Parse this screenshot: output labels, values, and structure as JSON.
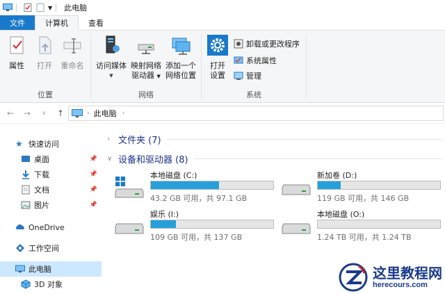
{
  "window": {
    "title": "此电脑"
  },
  "tabs": [
    {
      "label": "文件"
    },
    {
      "label": "计算机"
    },
    {
      "label": "查看"
    }
  ],
  "ribbon": {
    "location_group": {
      "label": "位置",
      "properties": "属性",
      "open": "打开",
      "rename": "重命名"
    },
    "network_group": {
      "label": "网络",
      "media_line1": "访问媒体",
      "map_line1": "映射网络",
      "map_line2": "驱动器",
      "add_line1": "添加一个",
      "add_line2": "网络位置"
    },
    "system_group": {
      "label": "系统",
      "settings_line1": "打开",
      "settings_line2": "设置",
      "uninstall": "卸载或更改程序",
      "sysprops": "系统属性",
      "manage": "管理"
    }
  },
  "address": {
    "path": "此电脑"
  },
  "nav": {
    "quick_access": "快速访问",
    "desktop": "桌面",
    "downloads": "下载",
    "documents": "文档",
    "pictures": "图片",
    "onedrive": "OneDrive",
    "workspace": "工作空间",
    "this_pc": "此电脑",
    "objects3d": "3D 对象"
  },
  "sections": {
    "folders": "文件夹 (7)",
    "devices": "设备和驱动器 (8)"
  },
  "drives": [
    {
      "name": "本地磁盘 (C:)",
      "usage": "43.2 GB 可用，共 97.1 GB",
      "used_fraction": 0.555
    },
    {
      "name": "新加卷 (D:)",
      "usage": "119 GB 可用，共 146 GB",
      "used_fraction": 0.185
    },
    {
      "name": "娱乐 (I:)",
      "usage": "109 GB 可用，共 137 GB",
      "used_fraction": 0.204
    },
    {
      "name": "本地磁盘 (O:)",
      "usage": "1.24 TB 可用，共 1.24 TB",
      "used_fraction": 0.0
    }
  ],
  "watermark": {
    "title": "这里教程网",
    "url": "herecours.com"
  },
  "colors": {
    "accent": "#1979ca",
    "bar_fill": "#26a0da",
    "section_text": "#1e3287"
  }
}
